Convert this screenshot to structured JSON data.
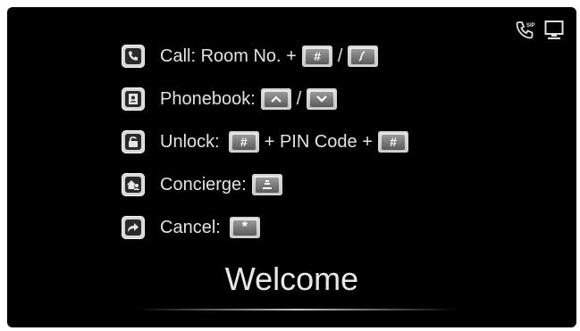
{
  "status_bar": {
    "icons": [
      "sip-phone-icon",
      "monitor-icon"
    ],
    "sip_label": "SIP"
  },
  "instructions": {
    "call": {
      "icon": "phone-icon",
      "label": "Call: Room No. +",
      "separator": "/",
      "keys": [
        "hash-key",
        "call-key"
      ],
      "hash_symbol": "#"
    },
    "phonebook": {
      "icon": "contact-book-icon",
      "label": "Phonebook:",
      "separator": "/",
      "keys": [
        "arrow-up-key",
        "arrow-down-key"
      ]
    },
    "unlock": {
      "icon": "padlock-icon",
      "label": "Unlock:",
      "middle": "+ PIN Code +",
      "keys": [
        "hash-key",
        "hash-key"
      ],
      "hash_symbol": "#"
    },
    "concierge": {
      "icon": "concierge-icon",
      "label": "Concierge:",
      "keys": [
        "concierge-key"
      ]
    },
    "cancel": {
      "icon": "cancel-arrow-icon",
      "label": "Cancel:",
      "keys": [
        "star-key"
      ],
      "star_symbol": "*"
    }
  },
  "welcome_text": "Welcome"
}
